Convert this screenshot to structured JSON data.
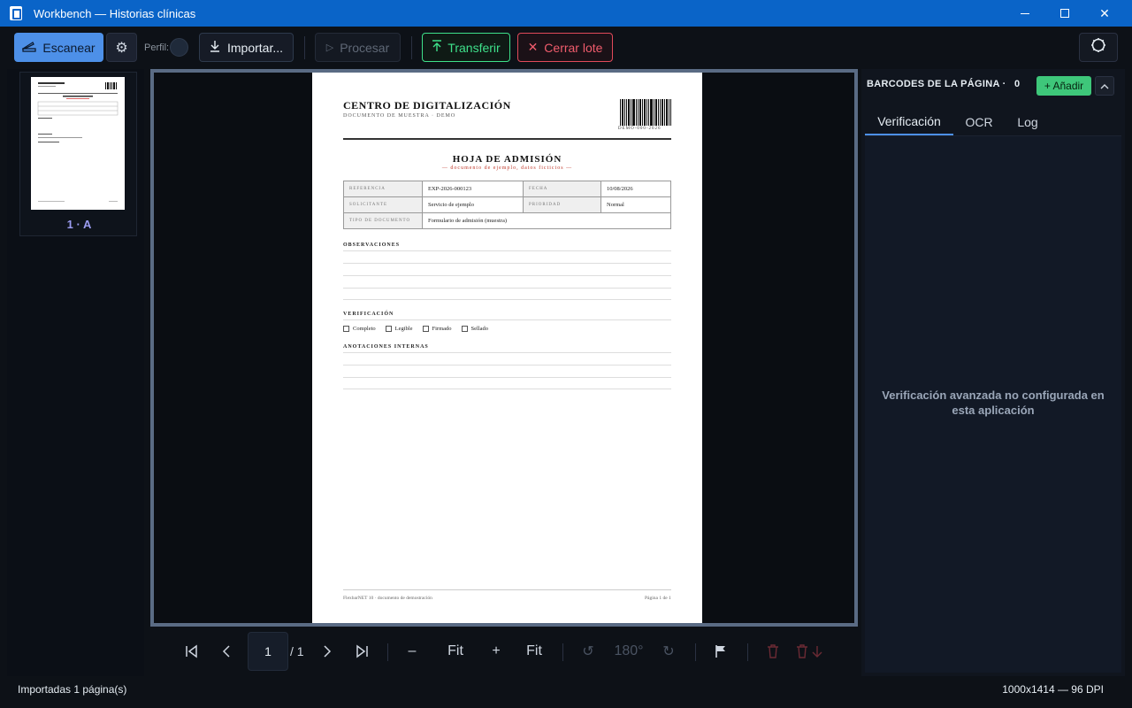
{
  "window": {
    "title": "Workbench — Historias clínicas"
  },
  "toolbar": {
    "scan_label": "Escanear",
    "profile_label": "Perfil:",
    "import_label": "Importar...",
    "process_label": "Procesar",
    "transfer_label": "Transferir",
    "close_lot_label": "Cerrar lote"
  },
  "thumbnails": [
    {
      "label": "1 · A"
    }
  ],
  "document": {
    "org": "CENTRO DE DIGITALIZACIÓN",
    "org_sub": "DOCUMENTO DE MUESTRA · DEMO",
    "barcode_text": "DEMO-000-2026",
    "title": "HOJA DE ADMISIÓN",
    "subtitle": "— documento de ejemplo, datos ficticios —",
    "fields": {
      "ref_key": "REFERENCIA",
      "ref_val": "EXP-2026-000123",
      "date_key": "FECHA",
      "date_val": "10/08/2026",
      "req_key": "SOLICITANTE",
      "req_val": "Servicio de ejemplo",
      "prio_key": "PRIORIDAD",
      "prio_val": "Normal",
      "type_key": "TIPO DE DOCUMENTO",
      "type_val": "Formulario de admisión (muestra)"
    },
    "sections": {
      "observations": "OBSERVACIONES",
      "verification": "VERIFICACIÓN",
      "notes": "ANOTACIONES INTERNAS"
    },
    "checks": [
      "Completo",
      "Legible",
      "Firmado",
      "Sellado"
    ],
    "footer_left": "FlexbarNET 10 · documento de demostración",
    "footer_right": "Página 1 de 1"
  },
  "nav": {
    "current_page": "1",
    "total_pages": "/ 1",
    "fit_label_1": "Fit",
    "fit_label_2": "Fit",
    "rotate_label": "180°"
  },
  "right_panel": {
    "header": "BARCODES DE LA PÁGINA ·",
    "count": "0",
    "add_label": "+ Añadir",
    "tabs": [
      "Verificación",
      "OCR",
      "Log"
    ],
    "active_tab": "Verificación",
    "message": "Verificación avanzada no configurada en esta aplicación"
  },
  "status": {
    "left": "Importadas 1 página(s)",
    "right": "1000x1414 — 96 DPI"
  },
  "colors": {
    "titlebar": "#0a64c8",
    "accent": "#4d90e8",
    "transfer": "#3ee08a",
    "close_lot": "#f05c6c",
    "add_button": "#3ec77a"
  }
}
